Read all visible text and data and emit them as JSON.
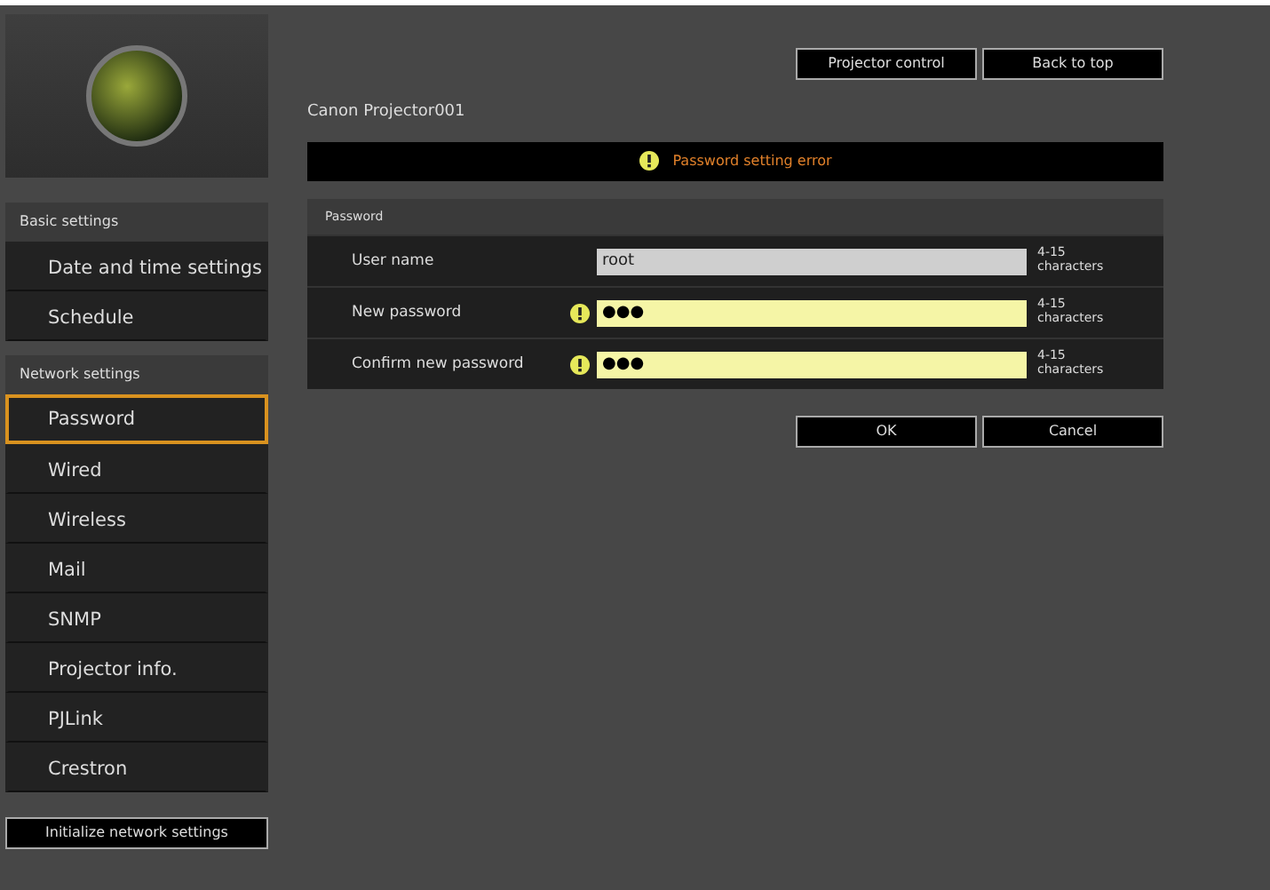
{
  "header_buttons": [
    {
      "label": "Projector control"
    },
    {
      "label": "Back to top"
    }
  ],
  "device_name": "Canon Projector001",
  "error_message": "Password setting error",
  "sidebar": {
    "sections": [
      {
        "title": "Basic settings",
        "items": [
          {
            "label": "Date and time settings",
            "selected": false
          },
          {
            "label": "Schedule",
            "selected": false
          }
        ]
      },
      {
        "title": "Network settings",
        "items": [
          {
            "label": "Password",
            "selected": true
          },
          {
            "label": "Wired",
            "selected": false
          },
          {
            "label": "Wireless",
            "selected": false
          },
          {
            "label": "Mail",
            "selected": false
          },
          {
            "label": "SNMP",
            "selected": false
          },
          {
            "label": "Projector info.",
            "selected": false
          },
          {
            "label": "PJLink",
            "selected": false
          },
          {
            "label": "Crestron",
            "selected": false
          }
        ]
      }
    ],
    "initialize_button": "Initialize network settings"
  },
  "panel": {
    "title": "Password",
    "fields": [
      {
        "label": "User name",
        "value": "root",
        "error": false,
        "disabled": true,
        "hint": "4-15 characters"
      },
      {
        "label": "New password",
        "value": "●●●",
        "error": true,
        "disabled": false,
        "hint": "4-15 characters"
      },
      {
        "label": "Confirm new password",
        "value": "●●●",
        "error": true,
        "disabled": false,
        "hint": "4-15 characters"
      }
    ]
  },
  "footer_buttons": [
    {
      "label": "OK"
    },
    {
      "label": "Cancel"
    }
  ]
}
